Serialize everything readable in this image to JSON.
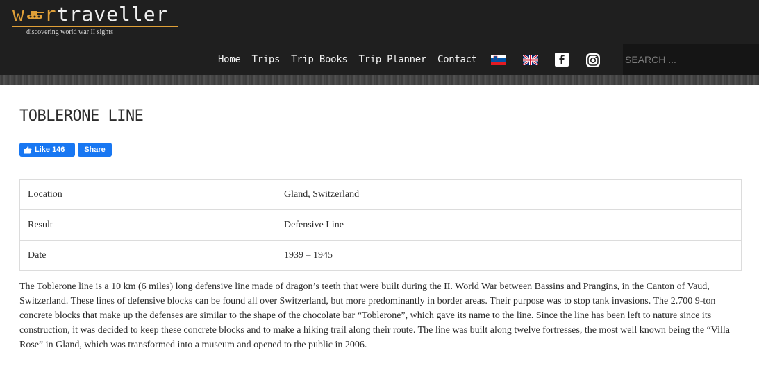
{
  "site": {
    "logo_accent_start": "w",
    "logo_accent_mid": "r",
    "logo_rest": "traveller",
    "tagline": "discovering world war II sights",
    "brand_color": "#e0a038"
  },
  "nav": {
    "items": [
      "Home",
      "Trips",
      "Trip Books",
      "Trip Planner",
      "Contact"
    ],
    "flags": [
      "slovenia-flag-icon",
      "uk-flag-icon"
    ],
    "social": [
      "facebook-icon",
      "instagram-icon"
    ],
    "search_placeholder": "SEARCH ..."
  },
  "page": {
    "title": "TOBLERONE LINE",
    "like_label": "Like 146",
    "share_label": "Share",
    "facts": [
      {
        "label": "Location",
        "value": "Gland, Switzerland"
      },
      {
        "label": "Result",
        "value": "Defensive Line"
      },
      {
        "label": "Date",
        "value": "1939 – 1945"
      }
    ],
    "body": "The Toblerone line is a 10 km (6 miles) long defensive line made of dragon’s teeth that were built during the II. World War between Bassins and Prangins, in the Canton of Vaud, Switzerland. These lines of defensive blocks can be found all over Switzerland, but more predominantly in border areas. Their purpose was to stop tank invasions. The 2.700 9-ton concrete blocks that make up the defenses are similar to the shape of the chocolate bar “Toblerone”, which gave its name to the line. Since the line has been left to nature since its construction, it was decided to keep these concrete blocks and to make a hiking trail along their route. The line was built along twelve fortresses, the most well known being the “Villa Rose” in Gland, which was transformed into a museum and opened to the public in 2006."
  }
}
